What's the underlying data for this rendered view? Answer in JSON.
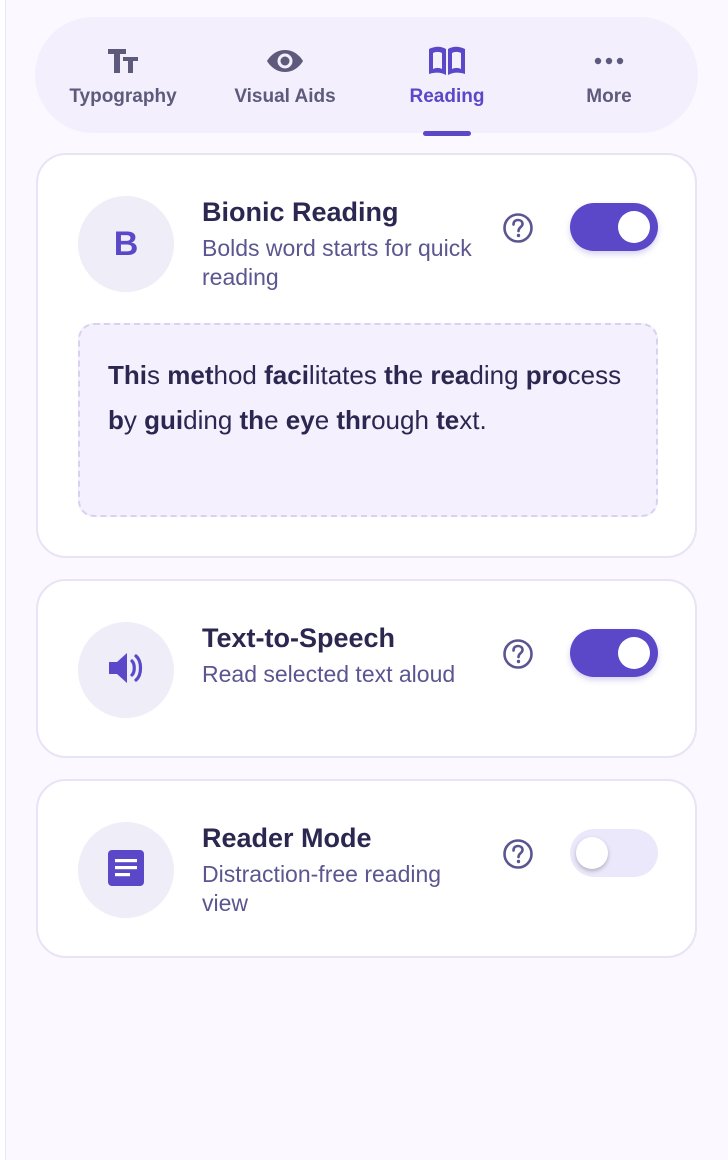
{
  "tabs": [
    {
      "label": "Typography",
      "icon": "typography-icon",
      "active": false
    },
    {
      "label": "Visual Aids",
      "icon": "eye-icon",
      "active": false
    },
    {
      "label": "Reading",
      "icon": "book-icon",
      "active": true
    },
    {
      "label": "More",
      "icon": "more-dots-icon",
      "active": false
    }
  ],
  "bionic": {
    "avatar_letter": "B",
    "title": "Bionic Reading",
    "description": "Bolds word starts for quick reading",
    "enabled": true,
    "preview_words": [
      {
        "bold": "Thi",
        "rest": "s"
      },
      {
        "bold": "met",
        "rest": "hod"
      },
      {
        "bold": "faci",
        "rest": "litates"
      },
      {
        "bold": "th",
        "rest": "e"
      },
      {
        "bold": "rea",
        "rest": "ding"
      },
      {
        "bold": "pro",
        "rest": "cess"
      },
      {
        "bold": "b",
        "rest": "y"
      },
      {
        "bold": "gui",
        "rest": "ding"
      },
      {
        "bold": "th",
        "rest": "e"
      },
      {
        "bold": "ey",
        "rest": "e"
      },
      {
        "bold": "thr",
        "rest": "ough"
      },
      {
        "bold": "te",
        "rest": "xt."
      }
    ]
  },
  "tts": {
    "title": "Text-to-Speech",
    "description": "Read selected text aloud",
    "icon": "speaker-icon",
    "enabled": true
  },
  "reader": {
    "title": "Reader Mode",
    "description": "Distraction-free reading view",
    "icon": "document-icon",
    "enabled": false
  },
  "colors": {
    "accent": "#5a48c8",
    "text_dark": "#2b2750",
    "text_muted": "#5b5590",
    "panel_bg": "#fbf8ff"
  }
}
